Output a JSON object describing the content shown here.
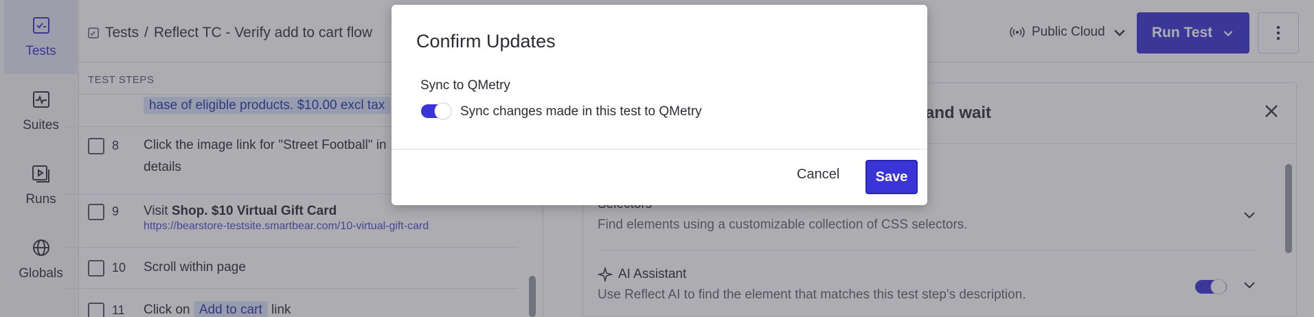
{
  "nav": {
    "items": [
      {
        "label": "Tests",
        "icon": "tests-icon"
      },
      {
        "label": "Suites",
        "icon": "suites-icon"
      },
      {
        "label": "Runs",
        "icon": "runs-icon"
      },
      {
        "label": "Globals",
        "icon": "globals-icon"
      }
    ]
  },
  "header": {
    "crumb_root": "Tests",
    "crumb_sep": "/",
    "crumb_current": "Reflect TC - Verify add to cart flow",
    "environment": "Public Cloud",
    "run_label": "Run Test"
  },
  "steps": {
    "title": "TEST STEPS",
    "partial_text": "hase of eligible products. $10.00 excl tax",
    "rows": [
      {
        "num": "8",
        "text": "Click the image link for \"Street Football\" in",
        "text2": "details"
      },
      {
        "num": "9",
        "prefix": "Visit ",
        "bold": "Shop. $10 Virtual Gift Card",
        "url": "https://bearstore-testsite.smartbear.com/10-virtual-gift-card"
      },
      {
        "num": "10",
        "text": "Scroll within page"
      },
      {
        "num": "11",
        "prefix": "Click on",
        "chip": "Add to cart",
        "suffix": "link"
      }
    ]
  },
  "detail": {
    "title_fragment": "and wait",
    "sections": [
      {
        "title": "Selectors",
        "desc": "Find elements using a customizable collection of CSS selectors."
      },
      {
        "title": "AI Assistant",
        "desc": "Use Reflect AI to find the element that matches this test step's description.",
        "enabled": true
      }
    ]
  },
  "modal": {
    "title": "Confirm Updates",
    "section_label": "Sync to QMetry",
    "toggle_label": "Sync changes made in this test to QMetry",
    "toggle_on": true,
    "cancel": "Cancel",
    "save": "Save"
  },
  "colors": {
    "accent": "#3a34d6",
    "nav_active_bg": "#e4e3f7",
    "highlight_bg": "#d9e2fb"
  }
}
